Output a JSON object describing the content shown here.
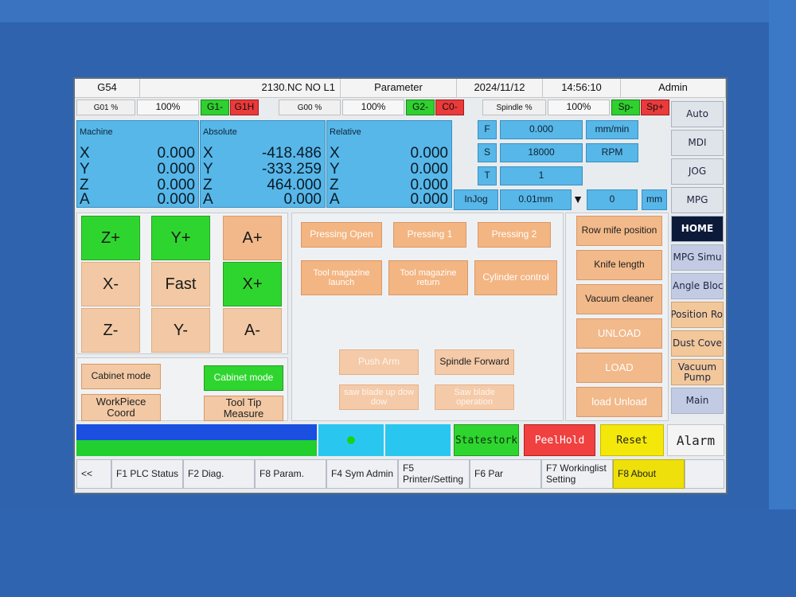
{
  "header": {
    "mode": "G54",
    "program": "2130.NC NO L1",
    "screen": "Parameter",
    "date": "2024/11/12",
    "time": "14:56:10",
    "user": "Admin"
  },
  "overrides": {
    "g01_label": "G01 %",
    "g01_value": "100%",
    "g1_minus": "G1-",
    "g1_high": "G1H",
    "g00_label": "G00 %",
    "g00_value": "100%",
    "g2_minus": "G2-",
    "c0_minus": "C0-",
    "spindle_label": "Spindle %",
    "spindle_value": "100%",
    "sp_minus": "Sp-",
    "sp_plus": "Sp+"
  },
  "coords": {
    "machine": {
      "title": "Machine",
      "axes": [
        "X",
        "Y",
        "Z",
        "A"
      ],
      "values": [
        "0.000",
        "0.000",
        "0.000",
        "0.000"
      ]
    },
    "absolute": {
      "title": "Absolute",
      "axes": [
        "X",
        "Y",
        "Z",
        "A"
      ],
      "values": [
        "-418.486",
        "-333.259",
        "464.000",
        "0.000"
      ]
    },
    "relative": {
      "title": "Relative",
      "axes": [
        "X",
        "Y",
        "Z",
        "A"
      ],
      "values": [
        "0.000",
        "0.000",
        "0.000",
        "0.000"
      ]
    }
  },
  "status": {
    "f_label": "F",
    "f_value": "0.000",
    "f_unit": "mm/min",
    "s_label": "S",
    "s_value": "18000",
    "s_unit": "RPM",
    "t_label": "T",
    "t_value": "1",
    "injog_label": "InJog",
    "injog_step": "0.01mm",
    "injog_arrow": "▼",
    "injog_value": "0",
    "injog_unit": "mm"
  },
  "sidebar": [
    "Auto",
    "MDI",
    "JOG",
    "MPG",
    "HOME",
    "MPG Simu",
    "Angle Block",
    "Position Ro",
    "Dust Cover",
    "Vacuum Pump",
    "Main"
  ],
  "jog": {
    "z_plus": "Z+",
    "y_plus": "Y+",
    "a_plus": "A+",
    "x_minus": "X-",
    "fast": "Fast",
    "x_plus": "X+",
    "z_minus": "Z-",
    "y_minus": "Y-",
    "a_minus": "A-"
  },
  "modes": {
    "cabinet_left": "Cabinet mode",
    "cabinet_right": "Cabinet mode",
    "workpiece": "WorkPiece Coord",
    "tool_tip": "Tool Tip Measure"
  },
  "functions": {
    "pressing_open": "Pressing Open",
    "pressing_1": "Pressing 1",
    "pressing_2": "Pressing 2",
    "tool_launch": "Tool magazine launch",
    "tool_return": "Tool magazine return",
    "cylinder": "Cylinder control",
    "push_arm": "Push Arm",
    "spindle_forward": "Spindle Forward",
    "saw_up_down": "saw blade up dow dow",
    "saw_operation": "Saw blade operation"
  },
  "right_buttons": [
    "Row mife position",
    "Knife length",
    "Vacuum cleaner",
    "UNLOAD",
    "LOAD",
    "load Unload"
  ],
  "status_bar": {
    "statestork": "Statestork",
    "peelhold": "PeelHold",
    "reset": "Reset",
    "alarm": "Alarm"
  },
  "fkeys": [
    "<<",
    "F1 PLC Status",
    "F2 Diag.",
    "F8 Param.",
    "F4 Sym Admin",
    "F5 Printer/Setting",
    "F6 Par",
    "F7 Workinglist Setting",
    "F8 About"
  ],
  "colors": {
    "accent_green": "#2fd02f",
    "panel_blue": "#57b7e8",
    "button_orange": "#f3b582",
    "alarm_red": "#ea3a3a",
    "about_yellow": "#eee00b"
  }
}
